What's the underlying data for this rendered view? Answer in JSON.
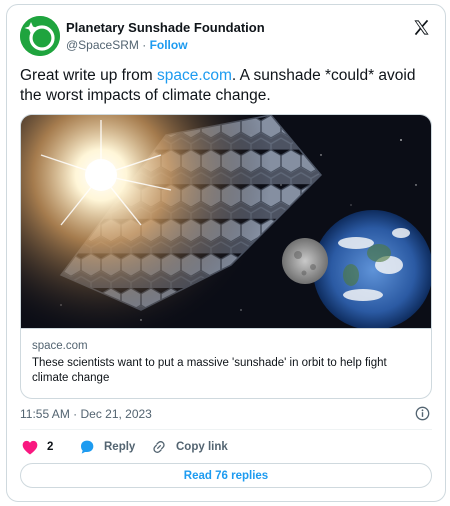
{
  "author": {
    "name": "Planetary Sunshade Foundation",
    "handle": "@SpaceSRM",
    "separator": "·",
    "follow_label": "Follow",
    "avatar_color": "#1fa43e"
  },
  "tweet": {
    "text_before": "Great write up from ",
    "link_text": "space.com",
    "text_after": ". A sunshade *could* avoid the worst impacts of climate change."
  },
  "link_card": {
    "image_alt": "sunshade-in-orbit-illustration",
    "domain": "space.com",
    "title": "These scientists want to put a massive 'sunshade' in orbit to help fight climate change"
  },
  "timestamp": "11:55 AM · Dec 21, 2023",
  "actions": {
    "like_count": "2",
    "reply_label": "Reply",
    "copy_label": "Copy link"
  },
  "read_replies_label": "Read 76 replies",
  "colors": {
    "accent": "#1d9bf0",
    "like": "#f91880",
    "text": "#0f1419",
    "muted": "#536471"
  },
  "icons": [
    "x-logo-icon",
    "info-icon",
    "heart-icon",
    "reply-bubble-icon",
    "link-icon"
  ]
}
